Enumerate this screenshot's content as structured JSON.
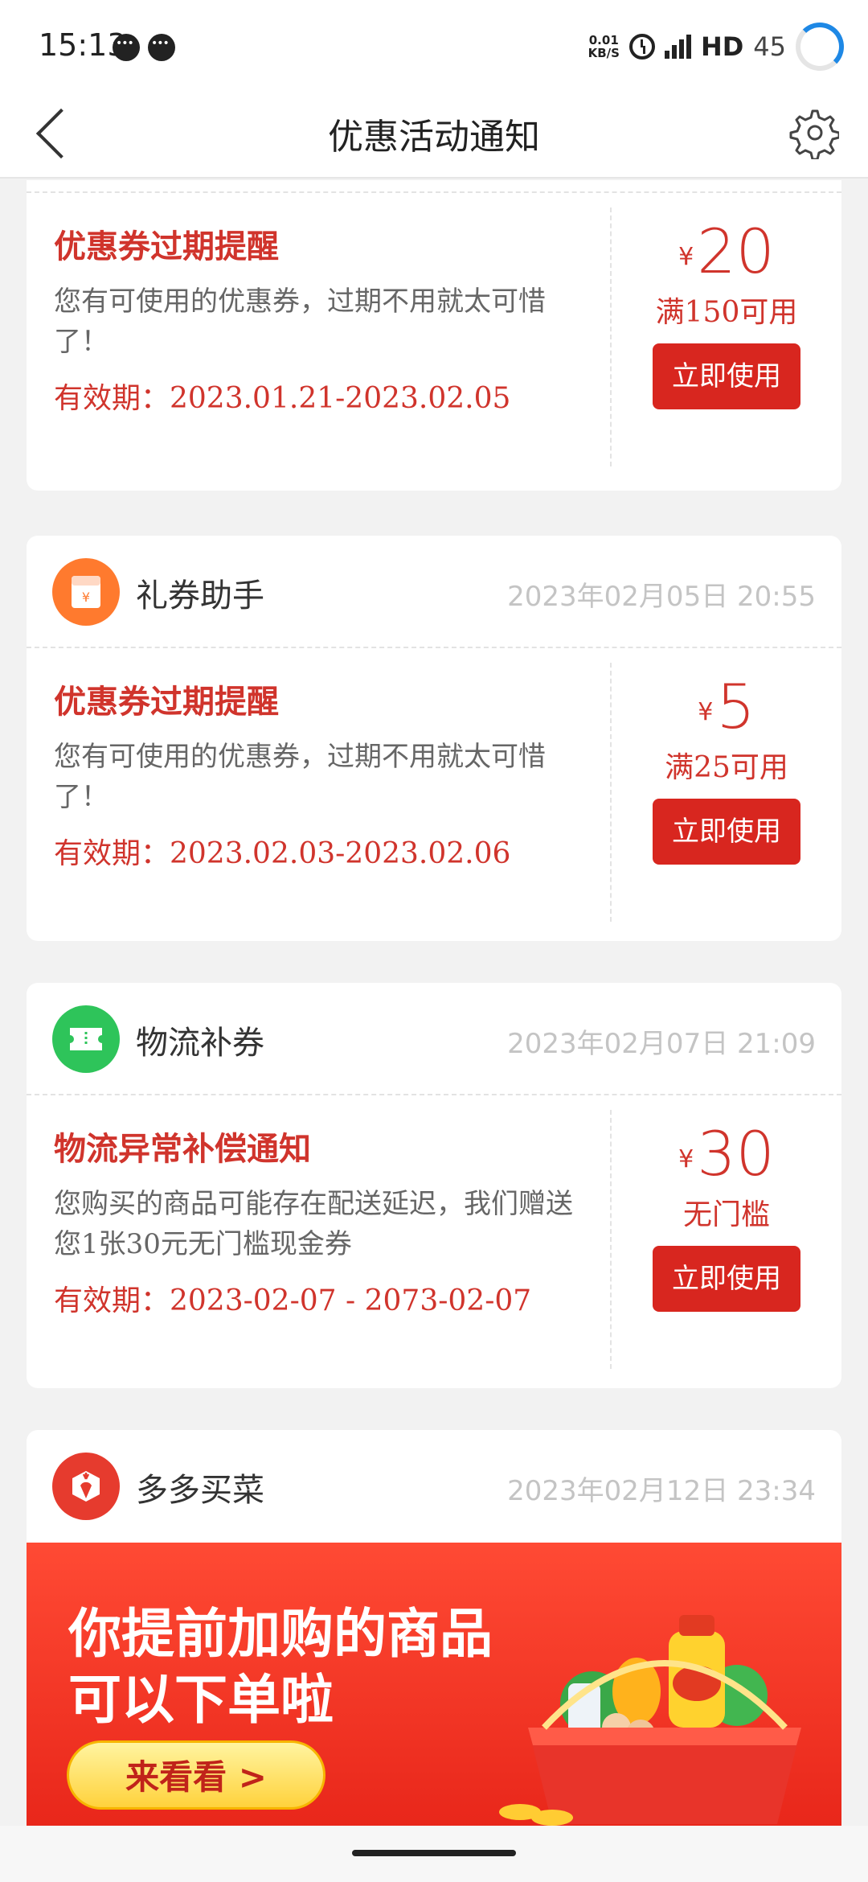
{
  "status_bar": {
    "time": "15:13",
    "net_speed_value": "0.01",
    "net_speed_unit": "KB/S",
    "network": "HD",
    "battery": "45"
  },
  "nav": {
    "title": "优惠活动通知"
  },
  "cards": [
    {
      "title": "优惠券过期提醒",
      "desc": "您有可使用的优惠券，过期不用就太可惜了！",
      "valid": "有效期：2023.01.21-2023.02.05",
      "currency": "¥",
      "amount": "20",
      "condition": "满150可用",
      "button": "立即使用"
    },
    {
      "sender": "礼券助手",
      "time": "2023年02月05日  20:55",
      "title": "优惠券过期提醒",
      "desc": "您有可使用的优惠券，过期不用就太可惜了！",
      "valid": "有效期：2023.02.03-2023.02.06",
      "currency": "¥",
      "amount": "5",
      "condition": "满25可用",
      "button": "立即使用"
    },
    {
      "sender": "物流补券",
      "time": "2023年02月07日  21:09",
      "title": "物流异常补偿通知",
      "desc": "您购买的商品可能存在配送延迟，我们赠送您1张30元无门槛现金券",
      "valid": "有效期：2023-02-07  -  2073-02-07",
      "currency": "¥",
      "amount": "30",
      "condition": "无门槛",
      "button": "立即使用"
    },
    {
      "sender": "多多买菜",
      "time": "2023年02月12日  23:34",
      "banner_line1": "你提前加购的商品",
      "banner_line2": "可以下单啦",
      "banner_button": "来看看 >"
    }
  ],
  "colors": {
    "accent_red": "#d0342c",
    "button_red": "#d8261f",
    "orange_avatar": "#ff7a2e",
    "green_avatar": "#2ec45a",
    "red_avatar": "#e63b2e"
  }
}
